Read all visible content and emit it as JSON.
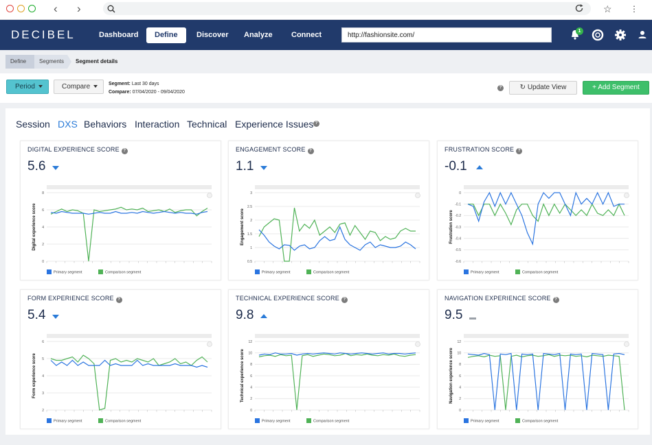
{
  "browser": {
    "url": ""
  },
  "app": {
    "logo": "DECIBEL",
    "nav": [
      "Dashboard",
      "Define",
      "Discover",
      "Analyze",
      "Connect"
    ],
    "active_nav": "Define",
    "site_url": "http://fashionsite.com/",
    "notification_count": "1"
  },
  "breadcrumb": [
    "Define",
    "Segments",
    "Segment details"
  ],
  "toolbar": {
    "period_label": "Period",
    "compare_label": "Compare",
    "segment_label": "Segment:",
    "segment_value": "Last 30 days",
    "compare_info_label": "Compare:",
    "compare_info_value": "07/04/2020 - 09/04/2020",
    "update_label": "Update View",
    "add_segment_label": "+ Add Segment"
  },
  "tabs": [
    "Session",
    "DXS",
    "Behaviors",
    "Interaction",
    "Technical",
    "Experience Issues"
  ],
  "active_tab": "DXS",
  "colors": {
    "primary": "#2a74e0",
    "comparison": "#4fb256",
    "accent": "#2a7bd8"
  },
  "legend": {
    "primary": "Primary segment",
    "comparison": "Comparison segment"
  },
  "chart_data": [
    {
      "type": "line",
      "title": "DIGITAL EXPERIENCE SCORE",
      "score": "5.6",
      "trend": "down",
      "ylabel": "Digital experience score",
      "ylim": [
        0,
        8
      ],
      "yticks": [
        0,
        2,
        4,
        6,
        8
      ],
      "series": [
        {
          "name": "Primary segment",
          "values": [
            5.7,
            5.6,
            5.8,
            5.7,
            5.6,
            5.6,
            5.6,
            5.5,
            5.6,
            5.7,
            5.6,
            5.6,
            5.8,
            5.6,
            5.6,
            5.7,
            5.6,
            5.8,
            5.7,
            5.6,
            5.7,
            5.8,
            5.7,
            5.6,
            5.7,
            5.6,
            5.6,
            5.5,
            5.7,
            5.8
          ]
        },
        {
          "name": "Comparison segment",
          "values": [
            5.5,
            5.8,
            6.1,
            5.8,
            6.0,
            5.9,
            5.6,
            0,
            6.0,
            5.8,
            5.9,
            6.0,
            6.1,
            6.3,
            6.0,
            6.1,
            6.0,
            6.2,
            5.8,
            5.9,
            6.0,
            5.8,
            6.1,
            5.7,
            5.9,
            6.0,
            6.0,
            5.3,
            5.8,
            6.2
          ]
        }
      ]
    },
    {
      "type": "line",
      "title": "ENGAGEMENT SCORE",
      "score": "1.1",
      "trend": "down",
      "ylabel": "Engagement score",
      "ylim": [
        0.5,
        3
      ],
      "yticks": [
        0.5,
        1,
        1.5,
        2,
        2.5,
        3
      ],
      "series": [
        {
          "name": "Primary segment",
          "values": [
            1.65,
            1.45,
            1.2,
            1.05,
            0.95,
            1.1,
            1.08,
            0.9,
            1.05,
            1.1,
            0.95,
            1.0,
            1.25,
            1.4,
            1.25,
            1.3,
            1.75,
            1.3,
            1.1,
            1.0,
            0.9,
            1.1,
            1.2,
            1.0,
            1.1,
            1.05,
            1.0,
            1.0,
            1.05,
            1.2,
            1.1,
            0.95
          ]
        },
        {
          "name": "Comparison segment",
          "values": [
            1.4,
            1.75,
            1.9,
            2.05,
            2.0,
            0,
            0,
            2.45,
            1.6,
            1.85,
            1.7,
            2.0,
            1.45,
            1.6,
            1.75,
            1.55,
            1.85,
            1.9,
            1.45,
            1.8,
            1.55,
            1.3,
            1.6,
            1.55,
            1.25,
            1.4,
            1.3,
            1.35,
            1.6,
            1.7,
            1.6,
            1.6
          ]
        }
      ]
    },
    {
      "type": "line",
      "title": "FRUSTRATION SCORE",
      "score": "-0.1",
      "trend": "up",
      "ylabel": "Frustration score",
      "ylim": [
        -0.6,
        0
      ],
      "yticks": [
        -0.6,
        -0.5,
        -0.4,
        -0.3,
        -0.2,
        -0.1,
        0
      ],
      "series": [
        {
          "name": "Primary segment",
          "values": [
            -0.1,
            -0.12,
            -0.25,
            -0.08,
            0,
            -0.12,
            0,
            -0.1,
            0,
            -0.1,
            -0.2,
            -0.35,
            -0.45,
            -0.1,
            0,
            -0.05,
            0,
            0,
            -0.1,
            -0.2,
            0,
            -0.1,
            -0.05,
            -0.1,
            0,
            -0.1,
            0,
            -0.12,
            -0.1,
            -0.1
          ]
        },
        {
          "name": "Comparison segment",
          "values": [
            -0.1,
            -0.1,
            -0.2,
            -0.1,
            -0.1,
            -0.2,
            -0.1,
            -0.18,
            -0.28,
            -0.15,
            -0.1,
            -0.1,
            -0.2,
            -0.25,
            -0.1,
            -0.2,
            -0.1,
            -0.18,
            -0.1,
            -0.15,
            -0.2,
            -0.15,
            -0.2,
            -0.1,
            -0.18,
            -0.2,
            -0.15,
            -0.2,
            -0.1,
            -0.2
          ]
        }
      ]
    },
    {
      "type": "line",
      "title": "FORM EXPERIENCE SCORE",
      "score": "5.4",
      "trend": "down",
      "ylabel": "Form experience score",
      "ylim": [
        2,
        6
      ],
      "yticks": [
        2,
        3,
        4,
        5,
        6
      ],
      "series": [
        {
          "name": "Primary segment",
          "values": [
            4.9,
            4.6,
            4.8,
            4.6,
            4.9,
            4.6,
            4.8,
            4.6,
            4.6,
            4.6,
            4.9,
            4.6,
            4.7,
            4.6,
            4.6,
            4.6,
            4.9,
            4.6,
            4.7,
            4.6,
            4.6,
            4.6,
            4.6,
            4.7,
            4.6,
            4.6,
            4.6,
            4.5,
            4.6,
            4.5
          ]
        },
        {
          "name": "Comparison segment",
          "values": [
            5.0,
            4.9,
            4.9,
            5.0,
            5.1,
            4.8,
            5.2,
            5.0,
            4.7,
            2,
            2.1,
            4.9,
            5.0,
            4.8,
            4.9,
            4.8,
            5.0,
            4.9,
            4.8,
            5.0,
            4.6,
            4.7,
            4.8,
            5.0,
            4.7,
            4.8,
            4.6,
            4.9,
            5.1,
            4.8
          ]
        }
      ]
    },
    {
      "type": "line",
      "title": "TECHNICAL EXPERIENCE SCORE",
      "score": "9.8",
      "trend": "up",
      "ylabel": "Technical experience score",
      "ylim": [
        0,
        12
      ],
      "yticks": [
        0,
        2,
        4,
        6,
        8,
        10,
        12
      ],
      "series": [
        {
          "name": "Primary segment",
          "values": [
            9.6,
            9.8,
            9.7,
            10,
            9.8,
            9.8,
            9.9,
            9.6,
            9.8,
            9.9,
            9.8,
            9.9,
            10,
            9.9,
            9.8,
            10,
            9.9,
            9.8,
            9.9,
            10,
            9.9,
            9.8,
            9.9,
            10,
            9.8,
            9.9,
            9.9,
            9.8,
            9.9,
            10
          ]
        },
        {
          "name": "Comparison segment",
          "values": [
            9.3,
            9.5,
            9.6,
            9.4,
            9.7,
            9.5,
            9.6,
            0,
            9.5,
            9.7,
            9.4,
            9.6,
            9.8,
            9.7,
            9.5,
            9.6,
            9.9,
            9.5,
            9.7,
            9.6,
            9.8,
            9.6,
            9.5,
            9.7,
            9.6,
            9.8,
            9.5,
            9.4,
            9.6,
            9.7
          ]
        }
      ]
    },
    {
      "type": "line",
      "title": "NAVIGATION EXPERIENCE SCORE",
      "score": "9.5",
      "trend": "flat",
      "ylabel": "Navigation experience score",
      "ylim": [
        0,
        12
      ],
      "yticks": [
        0,
        2,
        4,
        6,
        8,
        10,
        12
      ],
      "series": [
        {
          "name": "Primary segment",
          "values": [
            9.8,
            9.7,
            9.6,
            9.9,
            9.7,
            0,
            9.8,
            9.7,
            9.9,
            0,
            9.8,
            9.7,
            9.8,
            0,
            9.9,
            9.8,
            9.7,
            9.9,
            0,
            9.8,
            9.7,
            9.8,
            0,
            9.9,
            9.8,
            9.7,
            0,
            9.8,
            9.9,
            9.7
          ]
        },
        {
          "name": "Comparison segment",
          "values": [
            9.2,
            9.4,
            9.5,
            9.3,
            9.6,
            9.4,
            9.5,
            0,
            9.4,
            9.6,
            9.3,
            9.5,
            9.6,
            9.4,
            9.5,
            9.7,
            9.4,
            9.6,
            9.5,
            9.6,
            9.4,
            9.5,
            9.3,
            9.6,
            9.5,
            9.4,
            9.6,
            9.5,
            9.4,
            0
          ]
        }
      ]
    }
  ]
}
